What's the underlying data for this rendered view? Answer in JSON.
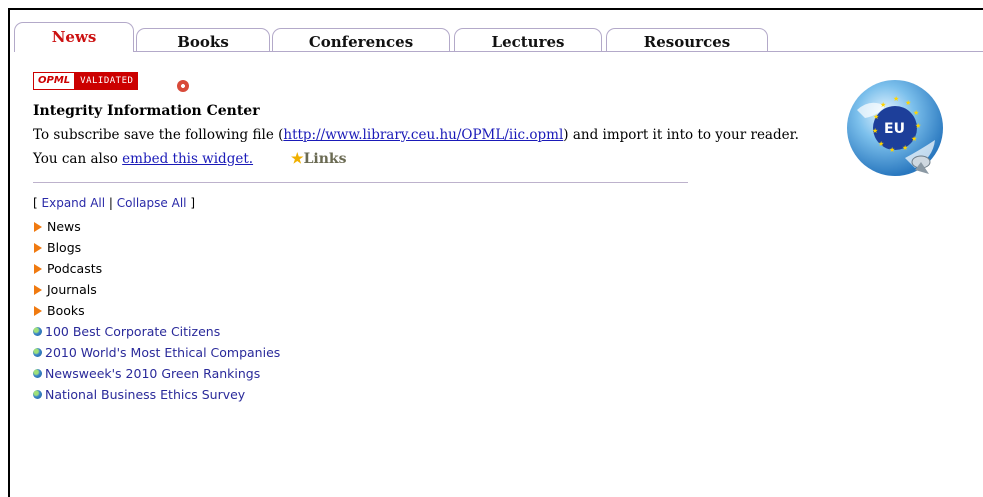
{
  "tabs": [
    {
      "label": "News",
      "active": true
    },
    {
      "label": "Books",
      "active": false
    },
    {
      "label": "Conferences",
      "active": false
    },
    {
      "label": "Lectures",
      "active": false
    },
    {
      "label": "Resources",
      "active": false
    }
  ],
  "badge": {
    "left": "OPML",
    "right": "VALIDATED"
  },
  "title": "Integrity Information Center",
  "subscribe": {
    "before": "To subscribe save the following file (",
    "link": "http://www.library.ceu.hu/OPML/iic.opml",
    "after": ") and import it into to your reader."
  },
  "embed": {
    "before": "You can also ",
    "link": "embed this widget."
  },
  "links_label": "Links",
  "controls": {
    "open": "[",
    "expand": "Expand All",
    "sep": "|",
    "collapse": "Collapse All",
    "close": "]"
  },
  "categories": [
    "News",
    "Blogs",
    "Podcasts",
    "Journals",
    "Books"
  ],
  "feeds": [
    "100 Best Corporate Citizens",
    "2010 World's Most Ethical Companies",
    "Newsweek's 2010 Green Rankings",
    "National Business Ethics Survey"
  ],
  "eu_logo_text": "EU",
  "colors": {
    "accent": "#cc1111",
    "link": "#1a1ab8",
    "arrow": "#f07a10"
  }
}
